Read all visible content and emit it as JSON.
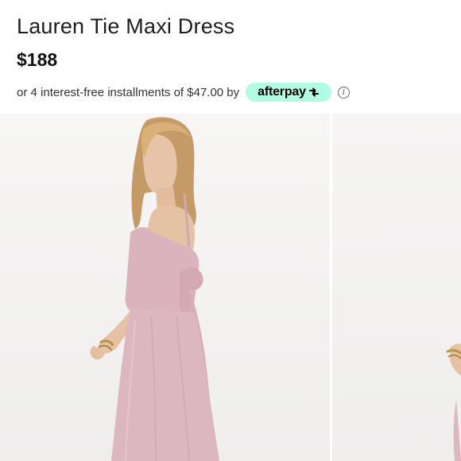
{
  "product": {
    "title": "Lauren Tie Maxi Dress",
    "price": "$188",
    "installments_text": "or 4 interest-free installments of $47.00 by",
    "afterpay_label": "afterpay",
    "afterpay_color": "#b2fce4",
    "info_glyph": "i"
  },
  "gallery": {
    "dress_color": "#dcb6bf",
    "hair_color": "#c59a63",
    "skin_color": "#e6c2a4"
  }
}
